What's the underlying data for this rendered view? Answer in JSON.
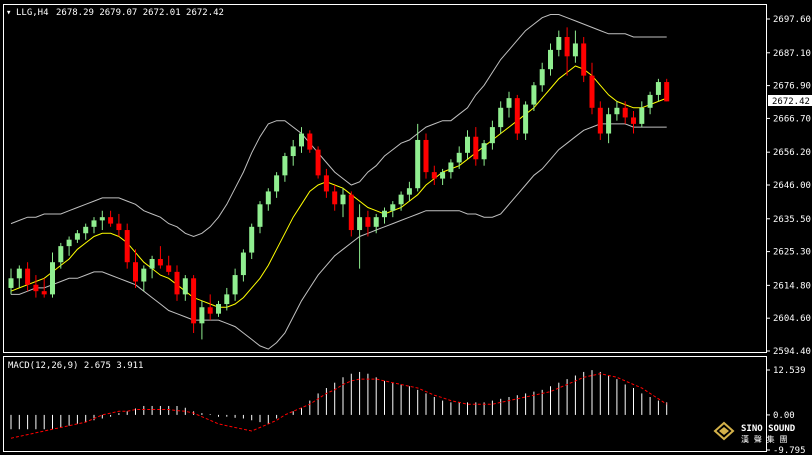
{
  "symbol_header": "LLG,H4",
  "ohlc_header": "2678.29 2679.07 2672.01 2672.42",
  "macd_header": "MACD(12,26,9) 2.675 3.911",
  "current_price_label": "2672.42",
  "price_axis_ticks": [
    "2697.60",
    "2687.10",
    "2676.90",
    "2666.70",
    "2656.20",
    "2646.00",
    "2635.50",
    "2625.30",
    "2614.80",
    "2604.60",
    "2594.40"
  ],
  "macd_axis_ticks": [
    "12.539",
    "0.00",
    "-9.795"
  ],
  "logo": {
    "brand": "SINO SOUND",
    "sub": "漢 聲 集 團"
  },
  "colors": {
    "background": "#000000",
    "bull": "#90EE90",
    "bear": "#FF0000",
    "ma": "#FFFF00",
    "bands": "#C0C0C0",
    "signal": "#FF0000",
    "axis": "#FFFFFF"
  },
  "chart_data": [
    {
      "type": "candlestick",
      "title": "LLG,H4",
      "ylim": [
        2594.4,
        2697.6
      ],
      "series": [
        {
          "name": "candles",
          "values": [
            [
              2614,
              2620,
              2612,
              2617
            ],
            [
              2617,
              2621,
              2614,
              2620
            ],
            [
              2620,
              2622,
              2613,
              2615
            ],
            [
              2615,
              2618,
              2611,
              2613
            ],
            [
              2613,
              2617,
              2611,
              2612
            ],
            [
              2612,
              2625,
              2611,
              2622
            ],
            [
              2622,
              2628,
              2620,
              2627
            ],
            [
              2627,
              2630,
              2624,
              2629
            ],
            [
              2629,
              2632,
              2628,
              2631
            ],
            [
              2631,
              2634,
              2629,
              2633
            ],
            [
              2633,
              2636,
              2631,
              2635
            ],
            [
              2635,
              2638,
              2632,
              2636
            ],
            [
              2636,
              2638,
              2633,
              2634
            ],
            [
              2634,
              2637,
              2630,
              2632
            ],
            [
              2632,
              2634,
              2620,
              2622
            ],
            [
              2622,
              2626,
              2614,
              2616
            ],
            [
              2616,
              2621,
              2613,
              2620
            ],
            [
              2620,
              2624,
              2617,
              2623
            ],
            [
              2623,
              2627,
              2620,
              2621
            ],
            [
              2621,
              2624,
              2618,
              2619
            ],
            [
              2619,
              2621,
              2610,
              2612
            ],
            [
              2612,
              2618,
              2610,
              2617
            ],
            [
              2617,
              2618,
              2600,
              2603
            ],
            [
              2603,
              2610,
              2598,
              2608
            ],
            [
              2608,
              2612,
              2604,
              2606
            ],
            [
              2606,
              2610,
              2605,
              2609
            ],
            [
              2609,
              2614,
              2607,
              2612
            ],
            [
              2612,
              2620,
              2610,
              2618
            ],
            [
              2618,
              2626,
              2616,
              2625
            ],
            [
              2625,
              2634,
              2623,
              2633
            ],
            [
              2633,
              2641,
              2631,
              2640
            ],
            [
              2640,
              2645,
              2638,
              2644
            ],
            [
              2644,
              2650,
              2642,
              2649
            ],
            [
              2649,
              2656,
              2647,
              2655
            ],
            [
              2655,
              2660,
              2652,
              2658
            ],
            [
              2658,
              2664,
              2656,
              2662
            ],
            [
              2662,
              2663,
              2656,
              2657
            ],
            [
              2657,
              2658,
              2648,
              2649
            ],
            [
              2649,
              2651,
              2642,
              2644
            ],
            [
              2644,
              2646,
              2638,
              2640
            ],
            [
              2640,
              2645,
              2636,
              2643
            ],
            [
              2643,
              2644,
              2630,
              2632
            ],
            [
              2632,
              2640,
              2620,
              2636
            ],
            [
              2636,
              2638,
              2630,
              2633
            ],
            [
              2633,
              2637,
              2631,
              2636
            ],
            [
              2636,
              2639,
              2634,
              2638
            ],
            [
              2638,
              2641,
              2636,
              2640
            ],
            [
              2640,
              2644,
              2638,
              2643
            ],
            [
              2643,
              2647,
              2641,
              2645
            ],
            [
              2645,
              2665,
              2644,
              2660
            ],
            [
              2660,
              2662,
              2648,
              2650
            ],
            [
              2650,
              2652,
              2646,
              2648
            ],
            [
              2648,
              2651,
              2646,
              2650
            ],
            [
              2650,
              2654,
              2648,
              2653
            ],
            [
              2653,
              2658,
              2651,
              2656
            ],
            [
              2656,
              2663,
              2654,
              2661
            ],
            [
              2661,
              2664,
              2652,
              2654
            ],
            [
              2654,
              2660,
              2652,
              2659
            ],
            [
              2659,
              2666,
              2657,
              2664
            ],
            [
              2664,
              2672,
              2662,
              2670
            ],
            [
              2670,
              2675,
              2667,
              2673
            ],
            [
              2673,
              2674,
              2660,
              2662
            ],
            [
              2662,
              2672,
              2660,
              2671
            ],
            [
              2671,
              2678,
              2669,
              2677
            ],
            [
              2677,
              2684,
              2675,
              2682
            ],
            [
              2682,
              2690,
              2680,
              2688
            ],
            [
              2688,
              2694,
              2686,
              2692
            ],
            [
              2692,
              2695,
              2680,
              2686
            ],
            [
              2686,
              2694,
              2684,
              2690
            ],
            [
              2690,
              2692,
              2678,
              2680
            ],
            [
              2680,
              2684,
              2668,
              2670
            ],
            [
              2670,
              2672,
              2660,
              2662
            ],
            [
              2662,
              2670,
              2659,
              2668
            ],
            [
              2668,
              2672,
              2666,
              2670
            ],
            [
              2670,
              2672,
              2665,
              2667
            ],
            [
              2667,
              2669,
              2662,
              2665
            ],
            [
              2665,
              2672,
              2664,
              2670
            ],
            [
              2670,
              2675,
              2668,
              2674
            ],
            [
              2674,
              2679,
              2672,
              2678
            ],
            [
              2678,
              2679,
              2672,
              2672
            ]
          ]
        },
        {
          "name": "moving average",
          "values": [
            2613,
            2614,
            2615,
            2616,
            2617,
            2619,
            2621,
            2623,
            2626,
            2628,
            2630,
            2631,
            2631,
            2630,
            2628,
            2625,
            2622,
            2620,
            2618,
            2617,
            2615,
            2613,
            2611,
            2610,
            2609,
            2608,
            2608,
            2609,
            2611,
            2614,
            2617,
            2621,
            2626,
            2631,
            2636,
            2640,
            2644,
            2646,
            2647,
            2646,
            2645,
            2643,
            2641,
            2639,
            2638,
            2637,
            2638,
            2639,
            2641,
            2643,
            2646,
            2648,
            2650,
            2651,
            2652,
            2654,
            2656,
            2658,
            2660,
            2662,
            2664,
            2666,
            2668,
            2670,
            2673,
            2676,
            2679,
            2681,
            2683,
            2682,
            2680,
            2677,
            2674,
            2672,
            2671,
            2670,
            2670,
            2671,
            2672,
            2673
          ]
        },
        {
          "name": "upper band",
          "values": [
            2634,
            2635,
            2636,
            2636,
            2637,
            2637,
            2637,
            2638,
            2639,
            2640,
            2641,
            2642,
            2642,
            2642,
            2641,
            2640,
            2638,
            2637,
            2636,
            2634,
            2633,
            2631,
            2630,
            2631,
            2633,
            2636,
            2640,
            2645,
            2650,
            2656,
            2661,
            2665,
            2666,
            2666,
            2664,
            2662,
            2659,
            2656,
            2653,
            2650,
            2648,
            2646,
            2647,
            2650,
            2652,
            2655,
            2657,
            2659,
            2660,
            2662,
            2664,
            2665,
            2666,
            2666,
            2668,
            2670,
            2674,
            2677,
            2681,
            2685,
            2688,
            2691,
            2694,
            2696,
            2698,
            2699,
            2699,
            2698,
            2697,
            2696,
            2695,
            2694,
            2693,
            2693,
            2693,
            2692,
            2692,
            2692,
            2692,
            2692
          ]
        },
        {
          "name": "lower band",
          "values": [
            2612,
            2612,
            2613,
            2614,
            2614,
            2615,
            2616,
            2617,
            2617,
            2618,
            2619,
            2619,
            2618,
            2617,
            2616,
            2615,
            2613,
            2611,
            2609,
            2607,
            2606,
            2605,
            2604,
            2604,
            2604,
            2604,
            2603,
            2602,
            2600,
            2598,
            2596,
            2595,
            2597,
            2600,
            2605,
            2610,
            2614,
            2618,
            2621,
            2624,
            2626,
            2628,
            2630,
            2631,
            2632,
            2633,
            2634,
            2635,
            2636,
            2637,
            2638,
            2638,
            2638,
            2638,
            2638,
            2637,
            2637,
            2636,
            2636,
            2637,
            2640,
            2643,
            2646,
            2649,
            2651,
            2654,
            2657,
            2659,
            2661,
            2663,
            2664,
            2665,
            2665,
            2665,
            2665,
            2664,
            2664,
            2664,
            2664,
            2664
          ]
        }
      ]
    },
    {
      "type": "bar",
      "title": "MACD(12,26,9) 2.675 3.911",
      "ylim": [
        -9.795,
        12.539
      ],
      "series": [
        {
          "name": "MACD",
          "values": [
            -4.0,
            -4.0,
            -4.0,
            -4.0,
            -4.0,
            -4.0,
            -3.5,
            -3.0,
            -2.5,
            -2.0,
            -1.5,
            -1.0,
            -0.5,
            0.5,
            1.0,
            1.8,
            2.5,
            2.5,
            2.5,
            2.5,
            2.5,
            2.0,
            1.0,
            0.5,
            0.2,
            -0.5,
            -0.5,
            -0.8,
            -1.0,
            -1.5,
            -2.0,
            -2.5,
            -1.0,
            0.0,
            1.0,
            2.0,
            4.0,
            6.0,
            7.5,
            9.0,
            10.5,
            11.5,
            12.0,
            11.5,
            10.5,
            9.5,
            9.0,
            8.5,
            8.0,
            7.0,
            6.0,
            5.0,
            4.0,
            3.5,
            3.5,
            3.5,
            3.5,
            3.5,
            4.0,
            4.5,
            5.0,
            5.5,
            6.0,
            6.5,
            7.0,
            8.0,
            9.0,
            10.0,
            11.0,
            12.0,
            12.5,
            12.0,
            11.0,
            10.0,
            8.5,
            7.5,
            6.0,
            5.0,
            4.0,
            3.5
          ]
        },
        {
          "name": "Signal",
          "values": [
            -6.5,
            -6.0,
            -5.5,
            -5.0,
            -4.5,
            -4.0,
            -3.5,
            -3.0,
            -2.5,
            -2.0,
            -1.0,
            0.0,
            0.5,
            1.0,
            1.0,
            1.5,
            1.5,
            1.5,
            1.5,
            1.5,
            1.2,
            1.0,
            0.5,
            -0.5,
            -1.5,
            -2.5,
            -3.0,
            -3.5,
            -4.0,
            -4.5,
            -3.5,
            -2.5,
            -1.5,
            0.0,
            1.0,
            2.0,
            3.0,
            4.5,
            6.0,
            7.0,
            8.5,
            9.5,
            10.0,
            10.0,
            10.0,
            9.5,
            9.0,
            8.5,
            8.0,
            7.5,
            6.5,
            5.5,
            4.8,
            4.0,
            3.5,
            3.0,
            3.0,
            3.0,
            3.0,
            3.5,
            4.0,
            4.5,
            5.0,
            5.5,
            6.0,
            6.5,
            7.5,
            8.5,
            9.5,
            10.5,
            11.0,
            11.5,
            11.0,
            10.5,
            9.5,
            8.5,
            7.5,
            6.0,
            4.5,
            3.0
          ]
        }
      ]
    }
  ]
}
